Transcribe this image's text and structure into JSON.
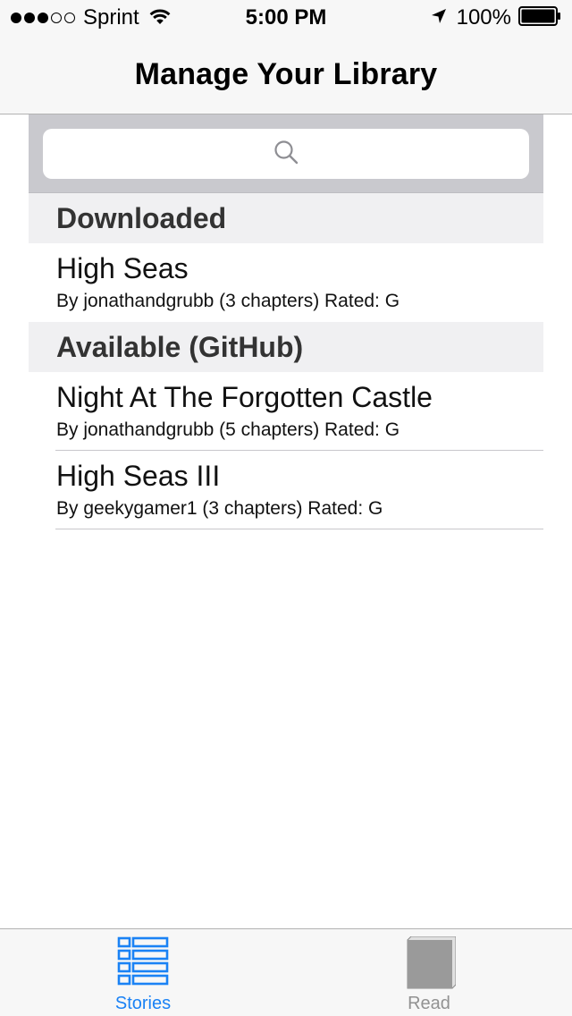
{
  "status_bar": {
    "signal_bars_filled": 3,
    "signal_bars_total": 5,
    "carrier": "Sprint",
    "time": "5:00 PM",
    "battery_percent": "100%",
    "icons": [
      "signal-dots",
      "wifi-icon",
      "location-arrow-icon",
      "battery-icon"
    ]
  },
  "nav": {
    "title": "Manage Your Library"
  },
  "search": {
    "placeholder": "",
    "value": "",
    "icon": "search-icon"
  },
  "sections": [
    {
      "header": "Downloaded",
      "rows": [
        {
          "title": "High Seas",
          "subtitle": "By jonathandgrubb (3 chapters) Rated: G"
        }
      ]
    },
    {
      "header": "Available (GitHub)",
      "rows": [
        {
          "title": "Night At The Forgotten Castle",
          "subtitle": "By jonathandgrubb (5 chapters) Rated: G"
        },
        {
          "title": "High Seas III",
          "subtitle": "By geekygamer1 (3 chapters) Rated: G"
        }
      ]
    }
  ],
  "tab_bar": {
    "tabs": [
      {
        "label": "Stories",
        "icon": "list-icon",
        "selected": true
      },
      {
        "label": "Read",
        "icon": "book-icon",
        "selected": false
      }
    ]
  },
  "colors": {
    "accent": "#1a82f5",
    "tab_inactive": "#929292",
    "search_bar_bg": "#c9c9ce",
    "section_header_bg": "#f0f0f2",
    "bar_bg": "#f7f7f7"
  }
}
